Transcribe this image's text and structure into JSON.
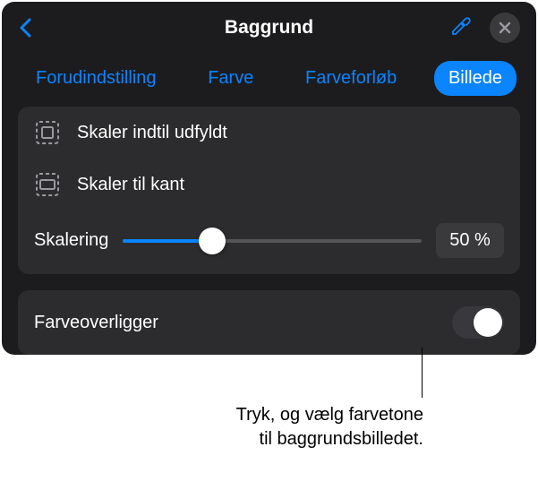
{
  "header": {
    "title": "Baggrund"
  },
  "tabs": {
    "preset": "Forudindstilling",
    "color": "Farve",
    "gradient": "Farveforløb",
    "image": "Billede"
  },
  "options": {
    "scale_fill": "Skaler indtil udfyldt",
    "scale_fit": "Skaler til kant"
  },
  "slider": {
    "label": "Skalering",
    "value": "50 %"
  },
  "overlay": {
    "label": "Farveoverligger"
  },
  "callout": {
    "line1": "Tryk, og vælg farvetone",
    "line2": "til baggrundsbilledet."
  }
}
